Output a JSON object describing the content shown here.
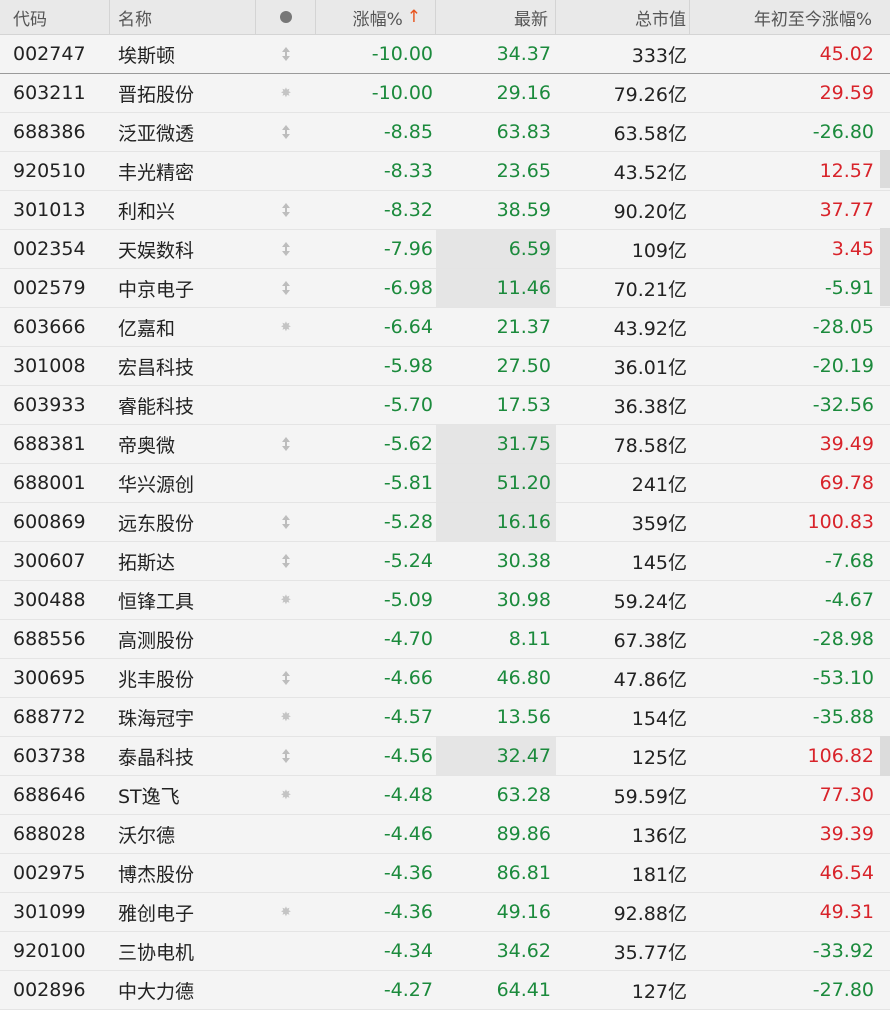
{
  "header": {
    "code": "代码",
    "name": "名称",
    "pct": "涨幅%",
    "sort_arrow": "↑",
    "last": "最新",
    "cap": "总市值",
    "ytd": "年初至今涨幅%"
  },
  "rows": [
    {
      "code": "002747",
      "name": "埃斯顿",
      "mark": "arrow",
      "pct": "-10.00",
      "last": "34.37",
      "cap": "333亿",
      "ytd": "45.02",
      "hl": false
    },
    {
      "code": "603211",
      "name": "晋拓股份",
      "mark": "star",
      "pct": "-10.00",
      "last": "29.16",
      "cap": "79.26亿",
      "ytd": "29.59",
      "hl": false
    },
    {
      "code": "688386",
      "name": "泛亚微透",
      "mark": "arrow",
      "pct": "-8.85",
      "last": "63.83",
      "cap": "63.58亿",
      "ytd": "-26.80",
      "hl": false
    },
    {
      "code": "920510",
      "name": "丰光精密",
      "mark": "",
      "pct": "-8.33",
      "last": "23.65",
      "cap": "43.52亿",
      "ytd": "12.57",
      "hl": false
    },
    {
      "code": "301013",
      "name": "利和兴",
      "mark": "arrow",
      "pct": "-8.32",
      "last": "38.59",
      "cap": "90.20亿",
      "ytd": "37.77",
      "hl": false
    },
    {
      "code": "002354",
      "name": "天娱数科",
      "mark": "arrow",
      "pct": "-7.96",
      "last": "6.59",
      "cap": "109亿",
      "ytd": "3.45",
      "hl": true
    },
    {
      "code": "002579",
      "name": "中京电子",
      "mark": "arrow",
      "pct": "-6.98",
      "last": "11.46",
      "cap": "70.21亿",
      "ytd": "-5.91",
      "hl": true
    },
    {
      "code": "603666",
      "name": "亿嘉和",
      "mark": "star",
      "pct": "-6.64",
      "last": "21.37",
      "cap": "43.92亿",
      "ytd": "-28.05",
      "hl": false
    },
    {
      "code": "301008",
      "name": "宏昌科技",
      "mark": "",
      "pct": "-5.98",
      "last": "27.50",
      "cap": "36.01亿",
      "ytd": "-20.19",
      "hl": false
    },
    {
      "code": "603933",
      "name": "睿能科技",
      "mark": "",
      "pct": "-5.70",
      "last": "17.53",
      "cap": "36.38亿",
      "ytd": "-32.56",
      "hl": false
    },
    {
      "code": "688381",
      "name": "帝奥微",
      "mark": "arrow",
      "pct": "-5.62",
      "last": "31.75",
      "cap": "78.58亿",
      "ytd": "39.49",
      "hl": true
    },
    {
      "code": "688001",
      "name": "华兴源创",
      "mark": "",
      "pct": "-5.81",
      "last": "51.20",
      "cap": "241亿",
      "ytd": "69.78",
      "hl": true
    },
    {
      "code": "600869",
      "name": "远东股份",
      "mark": "arrow",
      "pct": "-5.28",
      "last": "16.16",
      "cap": "359亿",
      "ytd": "100.83",
      "hl": true
    },
    {
      "code": "300607",
      "name": "拓斯达",
      "mark": "arrow",
      "pct": "-5.24",
      "last": "30.38",
      "cap": "145亿",
      "ytd": "-7.68",
      "hl": false
    },
    {
      "code": "300488",
      "name": "恒锋工具",
      "mark": "star",
      "pct": "-5.09",
      "last": "30.98",
      "cap": "59.24亿",
      "ytd": "-4.67",
      "hl": false
    },
    {
      "code": "688556",
      "name": "高测股份",
      "mark": "",
      "pct": "-4.70",
      "last": "8.11",
      "cap": "67.38亿",
      "ytd": "-28.98",
      "hl": false
    },
    {
      "code": "300695",
      "name": "兆丰股份",
      "mark": "arrow",
      "pct": "-4.66",
      "last": "46.80",
      "cap": "47.86亿",
      "ytd": "-53.10",
      "hl": false
    },
    {
      "code": "688772",
      "name": "珠海冠宇",
      "mark": "star",
      "pct": "-4.57",
      "last": "13.56",
      "cap": "154亿",
      "ytd": "-35.88",
      "hl": false
    },
    {
      "code": "603738",
      "name": "泰晶科技",
      "mark": "arrow",
      "pct": "-4.56",
      "last": "32.47",
      "cap": "125亿",
      "ytd": "106.82",
      "hl": true
    },
    {
      "code": "688646",
      "name": "ST逸飞",
      "mark": "star",
      "pct": "-4.48",
      "last": "63.28",
      "cap": "59.59亿",
      "ytd": "77.30",
      "hl": false
    },
    {
      "code": "688028",
      "name": "沃尔德",
      "mark": "",
      "pct": "-4.46",
      "last": "89.86",
      "cap": "136亿",
      "ytd": "39.39",
      "hl": false
    },
    {
      "code": "002975",
      "name": "博杰股份",
      "mark": "",
      "pct": "-4.36",
      "last": "86.81",
      "cap": "181亿",
      "ytd": "46.54",
      "hl": false
    },
    {
      "code": "301099",
      "name": "雅创电子",
      "mark": "star",
      "pct": "-4.36",
      "last": "49.16",
      "cap": "92.88亿",
      "ytd": "49.31",
      "hl": false
    },
    {
      "code": "920100",
      "name": "三协电机",
      "mark": "",
      "pct": "-4.34",
      "last": "34.62",
      "cap": "35.77亿",
      "ytd": "-33.92",
      "hl": false
    },
    {
      "code": "002896",
      "name": "中大力德",
      "mark": "",
      "pct": "-4.27",
      "last": "64.41",
      "cap": "127亿",
      "ytd": "-27.80",
      "hl": false
    }
  ],
  "colors": {
    "up": "#d8232a",
    "down": "#1b8a3c",
    "sort_arrow": "#e8541e"
  }
}
